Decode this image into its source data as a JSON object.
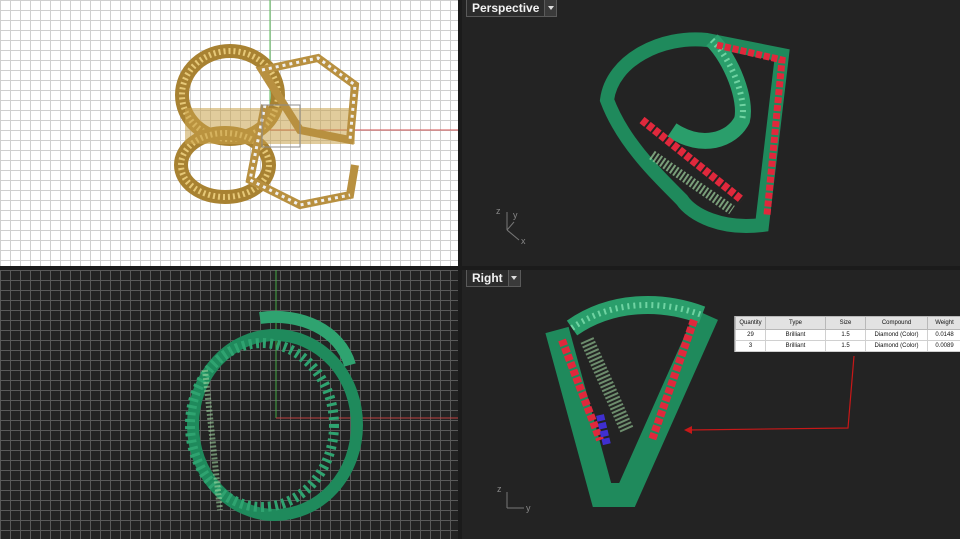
{
  "viewports": {
    "perspective": {
      "title": "Perspective"
    },
    "right": {
      "title": "Right"
    }
  },
  "axes": {
    "x": "x",
    "y": "y",
    "z": "z"
  },
  "stone_table": {
    "headers": [
      "Quantity",
      "Type",
      "Size",
      "Compound",
      "Weight"
    ],
    "rows": [
      [
        "29",
        "Brilliant",
        "1.5",
        "Diamond (Color)",
        "0.0148"
      ],
      [
        "3",
        "Brilliant",
        "1.5",
        "Diamond (Color)",
        "0.0089"
      ]
    ]
  },
  "colors": {
    "gold": "#c8a24a",
    "green": "#1f8a5c",
    "ruby": "#e0283c",
    "sapphire": "#3f2fd0",
    "annotation": "#c81818"
  },
  "icons": [
    "dropdown-arrow-icon",
    "axis-triad-icon"
  ]
}
